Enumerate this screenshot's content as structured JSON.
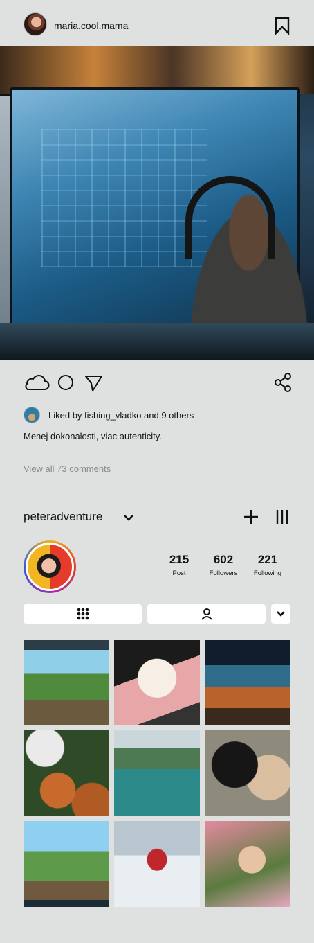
{
  "post": {
    "username": "maria.cool.mama",
    "likes_text": "Liked by fishing_vladko and 9 others",
    "caption": "Menej dokonalosti, viac autenticity.",
    "view_comments": "View all 73 comments"
  },
  "profile": {
    "username": "peteradventure",
    "stats": [
      {
        "value": "215",
        "label": "Post"
      },
      {
        "value": "602",
        "label": "Followers"
      },
      {
        "value": "221",
        "label": "Following"
      }
    ]
  },
  "icons": {
    "bookmark": "bookmark-icon",
    "like": "cloud-icon",
    "comment": "circle-icon",
    "send": "send-icon",
    "share": "share-icon",
    "dropdown": "chevron-down-icon",
    "add": "plus-icon",
    "menu": "bars-icon",
    "grid": "grid-icon",
    "tagged": "person-icon"
  },
  "grid_thumbnails": [
    "pixel-ruins",
    "anime-girl",
    "temple-battle",
    "sneaker-basketballs",
    "lake-boat",
    "pug-dogs",
    "pixel-jungle",
    "ice-hockey",
    "woman-camera"
  ]
}
